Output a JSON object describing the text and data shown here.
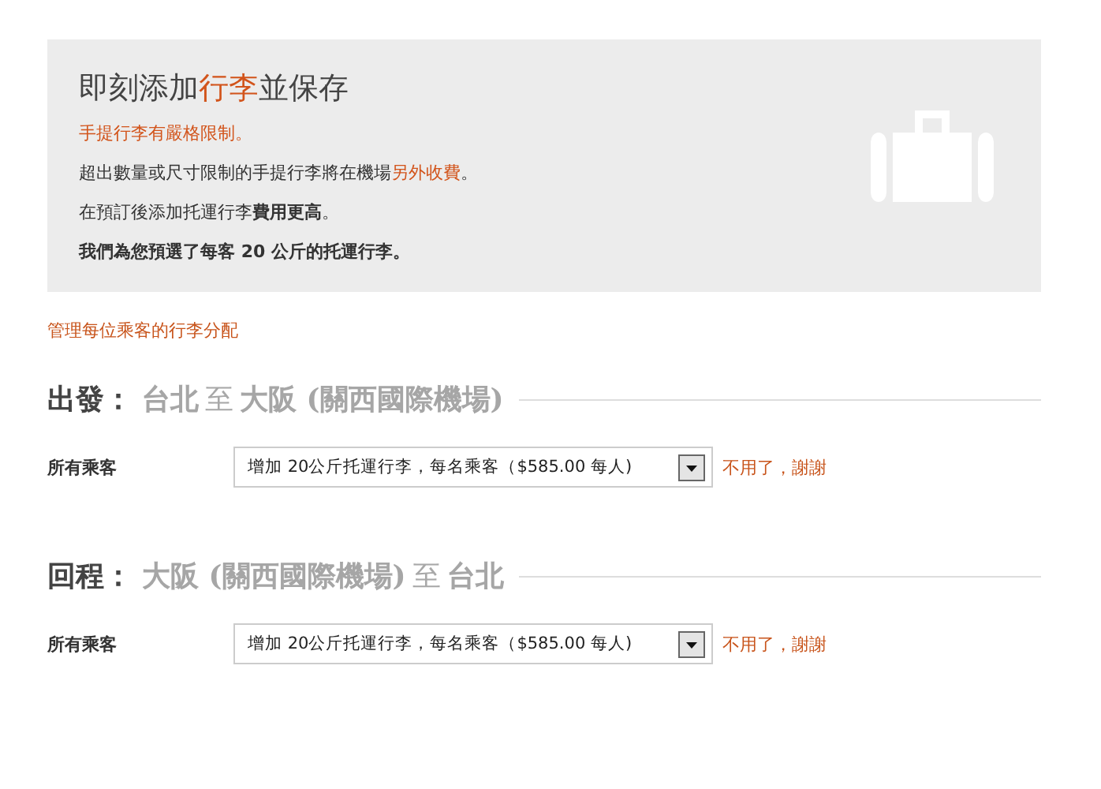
{
  "banner": {
    "title": [
      {
        "text": "即刻添加",
        "kind": "plain"
      },
      {
        "text": "行李",
        "kind": "accent"
      },
      {
        "text": "並保存",
        "kind": "plain"
      }
    ],
    "lines": [
      [
        {
          "text": "手提行李有嚴格限制。",
          "kind": "accent"
        }
      ],
      [
        {
          "text": "超出數量或尺寸限制的手提行李將在機場",
          "kind": "plain"
        },
        {
          "text": "另外收費",
          "kind": "accent"
        },
        {
          "text": "。",
          "kind": "plain"
        }
      ],
      [
        {
          "text": "在預訂後添加托運行李",
          "kind": "plain"
        },
        {
          "text": "費用更高",
          "kind": "bold"
        },
        {
          "text": "。",
          "kind": "plain"
        }
      ],
      [
        {
          "text": "我們為您預選了每客 20 公斤的托運行李。",
          "kind": "bold"
        }
      ]
    ]
  },
  "manage_link": "管理每位乘客的行李分配",
  "segments": [
    {
      "heading": [
        {
          "text": "出發：",
          "kind": "label"
        },
        {
          "text": "台北",
          "kind": "place"
        },
        {
          "text": "至",
          "kind": "connector"
        },
        {
          "text": "大阪 (關西國際機場)",
          "kind": "place"
        }
      ],
      "passenger_label": "所有乘客",
      "option": "增加 20公斤托運行李，每名乘客（$585.00 每人)",
      "decline_link": "不用了，謝謝"
    },
    {
      "heading": [
        {
          "text": "回程：",
          "kind": "label"
        },
        {
          "text": "大阪 (關西國際機場)",
          "kind": "place"
        },
        {
          "text": "至",
          "kind": "connector"
        },
        {
          "text": "台北",
          "kind": "place"
        }
      ],
      "passenger_label": "所有乘客",
      "option": "增加 20公斤托運行李，每名乘客（$585.00 每人)",
      "decline_link": "不用了，謝謝"
    }
  ]
}
